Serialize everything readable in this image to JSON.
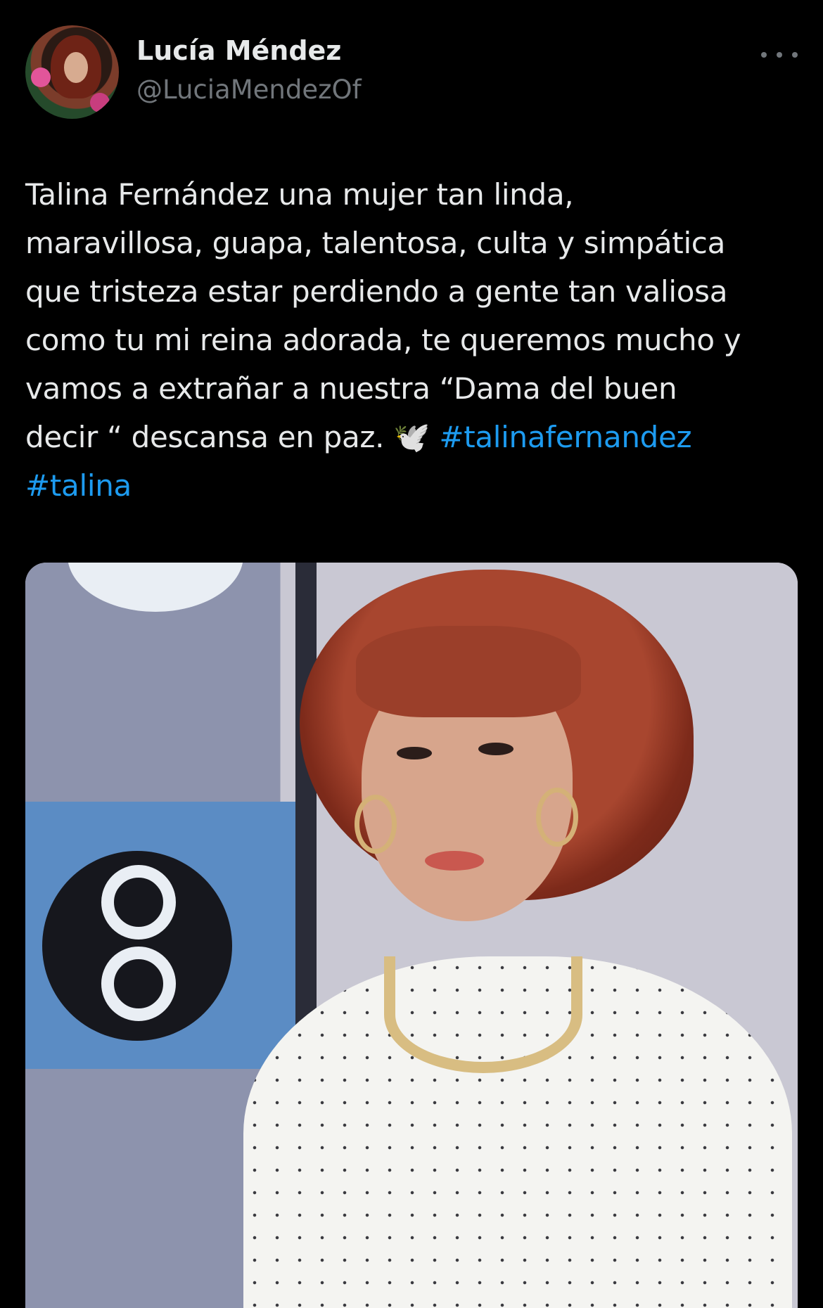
{
  "author": {
    "name": "Lucía Méndez",
    "handle": "@LuciaMendezOf",
    "avatar_icon": "profile-photo"
  },
  "more_menu": {
    "icon": "more-horizontal-icon"
  },
  "tweet": {
    "lines": [
      "Talina Fernández una mujer tan linda,",
      "maravillosa, guapa, talentosa, culta y simpática",
      "que tristeza estar perdiendo a gente tan valiosa",
      "como tu mi reina adorada, te queremos mucho y",
      "vamos a extrañar a nuestra “Dama del buen"
    ],
    "line6_text": "decir “ descansa en paz. ",
    "dove_emoji": "🕊️",
    "hashtags": [
      "#talinafernandez",
      "#talina"
    ]
  },
  "colors": {
    "background": "#000000",
    "text": "#e7e9ea",
    "secondary": "#71767b",
    "link": "#1d9bf0"
  }
}
